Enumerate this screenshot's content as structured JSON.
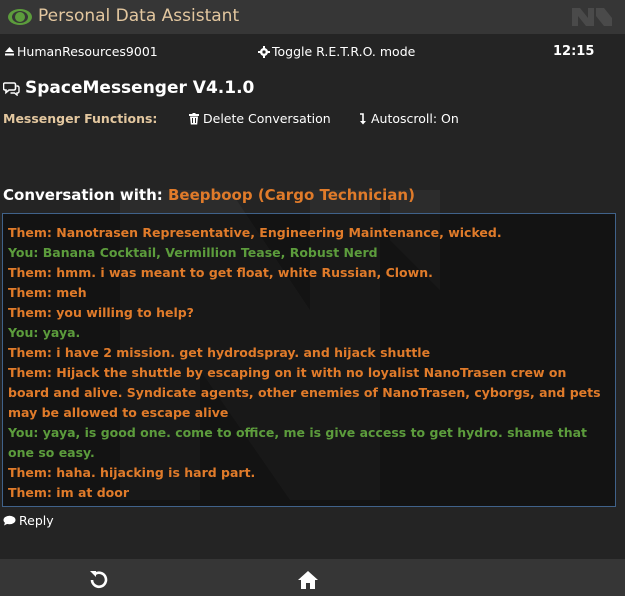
{
  "window": {
    "title": "Personal Data Assistant",
    "eye_icon": "eye-icon",
    "logo_icon": "nanotrasen-logo"
  },
  "status": {
    "user": "HumanResources9001",
    "user_icon": "eject-icon",
    "retro_label": "Toggle R.E.T.R.O. mode",
    "retro_icon": "gear-icon",
    "time": "12:15"
  },
  "app": {
    "title": "SpaceMessenger V4.1.0",
    "title_icon": "comments-icon"
  },
  "functions": {
    "label": "Messenger Functions:",
    "delete_label": "Delete Conversation",
    "delete_icon": "trash-icon",
    "autoscroll_label": "Autoscroll: On",
    "autoscroll_icon": "arrow-down-icon"
  },
  "conversation": {
    "prefix": "Conversation with:",
    "contact": "Beepboop (Cargo Technician)",
    "messages": [
      {
        "sender": "them",
        "text": "Them: Nanotrasen Representative, Engineering Maintenance, wicked."
      },
      {
        "sender": "you",
        "text": "You: Banana Cocktail, Vermillion Tease, Robust Nerd"
      },
      {
        "sender": "them",
        "text": "Them: hmm. i was meant to get float, white Russian, Clown."
      },
      {
        "sender": "them",
        "text": "Them: meh"
      },
      {
        "sender": "them",
        "text": "Them: you willing to help?"
      },
      {
        "sender": "you",
        "text": "You: yaya."
      },
      {
        "sender": "them",
        "text": "Them: i have 2 mission. get hydrodspray. and hijack shuttle"
      },
      {
        "sender": "them",
        "text": "Them: Hijack the shuttle by escaping on it with no loyalist NanoTrasen crew on board and alive. Syndicate agents, other enemies of NanoTrasen, cyborgs, and pets may be allowed to escape alive"
      },
      {
        "sender": "you",
        "text": "You: yaya, is good one. come to office, me is give access to get hydro. shame that one so easy."
      },
      {
        "sender": "them",
        "text": "Them: haha. hijacking is hard part."
      },
      {
        "sender": "them",
        "text": "Them: im at door"
      }
    ],
    "reply_label": "Reply",
    "reply_icon": "comment-icon"
  },
  "nav": {
    "refresh_icon": "refresh-icon",
    "home_icon": "home-icon"
  },
  "colors": {
    "background": "#242424",
    "bar": "#363636",
    "title_text": "#e3c79f",
    "them": "#e07b2a",
    "you": "#5c9c3c",
    "border": "#40628a"
  }
}
